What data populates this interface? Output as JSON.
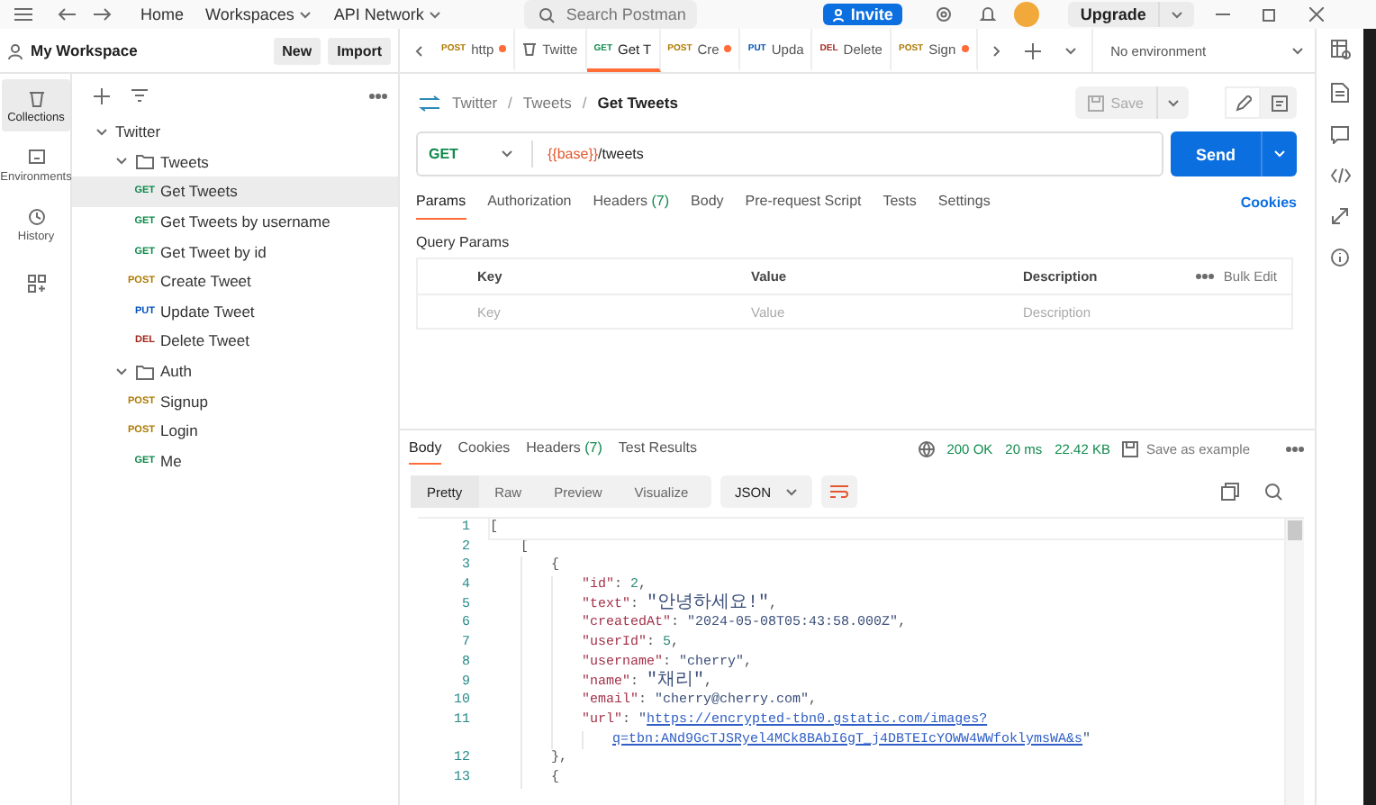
{
  "top_bar": {
    "nav": [
      {
        "label": "Home",
        "dropdown": false
      },
      {
        "label": "Workspaces",
        "dropdown": true
      },
      {
        "label": "API Network",
        "dropdown": true
      }
    ],
    "search": {
      "placeholder": "Search Postman"
    },
    "invite": "Invite",
    "upgrade": "Upgrade"
  },
  "workspace": {
    "name": "My Workspace",
    "buttons": [
      "New",
      "Import"
    ]
  },
  "nav_rail": [
    {
      "kind": "collections",
      "label": "Collections",
      "selected": true
    },
    {
      "kind": "environments",
      "label": "Environments",
      "selected": false
    },
    {
      "kind": "history",
      "label": "History",
      "selected": false
    },
    {
      "kind": "apps",
      "selected": false
    }
  ],
  "tree": [
    {
      "kind": "collection",
      "label": "Twitter",
      "expanded": true,
      "children": [
        {
          "kind": "folder",
          "label": "Tweets",
          "expanded": true,
          "children": [
            {
              "kind": "request",
              "method": "GET",
              "color": "#0f8a4c",
              "label": "Get Tweets",
              "selected": true
            },
            {
              "kind": "request",
              "method": "GET",
              "color": "#0f8a4c",
              "label": "Get Tweets by username",
              "selected": false
            },
            {
              "kind": "request",
              "method": "GET",
              "color": "#0f8a4c",
              "label": "Get Tweet by id",
              "selected": false
            },
            {
              "kind": "request",
              "method": "POST",
              "color": "#ad7a03",
              "label": "Create Tweet",
              "selected": false
            },
            {
              "kind": "request",
              "method": "PUT",
              "color": "#0053b8",
              "label": "Update Tweet",
              "selected": false
            },
            {
              "kind": "request",
              "method": "DEL",
              "color": "#a1261b",
              "label": "Delete Tweet",
              "selected": false
            }
          ]
        },
        {
          "kind": "folder",
          "label": "Auth",
          "expanded": true,
          "children": [
            {
              "kind": "request",
              "method": "POST",
              "color": "#ad7a03",
              "label": "Signup",
              "selected": false
            },
            {
              "kind": "request",
              "method": "POST",
              "color": "#ad7a03",
              "label": "Login",
              "selected": false
            },
            {
              "kind": "request",
              "method": "GET",
              "color": "#0f8a4c",
              "label": "Me",
              "selected": false
            }
          ]
        }
      ]
    }
  ],
  "tabs": [
    {
      "kind": "request",
      "method": "POST",
      "color": "#ad7a03",
      "label": "http",
      "unsaved": true,
      "selected": false
    },
    {
      "kind": "collection",
      "label": "Twitte",
      "unsaved": false,
      "selected": false
    },
    {
      "kind": "request",
      "method": "GET",
      "color": "#0f8a4c",
      "label": "Get T",
      "unsaved": false,
      "selected": true
    },
    {
      "kind": "request",
      "method": "POST",
      "color": "#ad7a03",
      "label": "Cre",
      "unsaved": true,
      "selected": false
    },
    {
      "kind": "request",
      "method": "PUT",
      "color": "#0053b8",
      "label": "Upda",
      "unsaved": false,
      "selected": false
    },
    {
      "kind": "request",
      "method": "DEL",
      "color": "#a1261b",
      "label": "Delete",
      "unsaved": false,
      "selected": false
    },
    {
      "kind": "request",
      "method": "POST",
      "color": "#ad7a03",
      "label": "Sign",
      "unsaved": true,
      "selected": false
    }
  ],
  "environment": "No environment",
  "breadcrumb": [
    {
      "label": "Twitter",
      "separator": "/"
    },
    {
      "label": "Tweets",
      "separator": "/"
    },
    {
      "label": "Get Tweets"
    }
  ],
  "save": "Save",
  "request": {
    "method": "GET",
    "url_variable": "{{base}}",
    "url_path": "/tweets",
    "send": "Send"
  },
  "request_tabs": [
    {
      "label": "Params",
      "selected": true
    },
    {
      "label": "Authorization",
      "selected": false
    },
    {
      "label": "Headers",
      "count": "(7)",
      "selected": false
    },
    {
      "label": "Body",
      "selected": false
    },
    {
      "label": "Pre-request Script",
      "selected": false
    },
    {
      "label": "Tests",
      "selected": false
    },
    {
      "label": "Settings",
      "selected": false
    }
  ],
  "cookies": "Cookies",
  "query_params": {
    "title": "Query Params",
    "columns": [
      "Key",
      "Value",
      "Description"
    ],
    "bulk_edit": "Bulk Edit",
    "placeholders": [
      "Key",
      "Value",
      "Description"
    ]
  },
  "response": {
    "tabs": [
      {
        "label": "Body",
        "selected": true
      },
      {
        "label": "Cookies",
        "selected": false
      },
      {
        "label": "Headers",
        "count": "(7)",
        "selected": false
      },
      {
        "label": "Test Results",
        "selected": false
      }
    ],
    "status": "200 OK",
    "time": "20 ms",
    "size": "22.42 KB",
    "save_example": "Save as example",
    "views": [
      {
        "label": "Pretty",
        "selected": true
      },
      {
        "label": "Raw",
        "selected": false
      },
      {
        "label": "Preview",
        "selected": false
      },
      {
        "label": "Visualize",
        "selected": false
      }
    ],
    "format": "JSON",
    "lines": [
      {
        "number": "1",
        "tokens": [
          {
            "kind": "punct",
            "text": "["
          }
        ],
        "children": [
          {
            "number": "2",
            "tokens": [
              {
                "kind": "punct",
                "text": "["
              }
            ],
            "children": [
              {
                "number": "3",
                "tokens": [
                  {
                    "kind": "punct",
                    "text": "{"
                  }
                ],
                "children": [
                  {
                    "number": "4",
                    "tokens": [
                      {
                        "kind": "key",
                        "text": "\"id\""
                      },
                      {
                        "kind": "punct",
                        "text": ": "
                      },
                      {
                        "kind": "number",
                        "text": "2"
                      },
                      {
                        "kind": "punct",
                        "text": ","
                      }
                    ]
                  },
                  {
                    "number": "5",
                    "tokens": [
                      {
                        "kind": "key",
                        "text": "\"text\""
                      },
                      {
                        "kind": "punct",
                        "text": ": "
                      },
                      {
                        "kind": "string_ko",
                        "text": "\"안녕하세요!\""
                      },
                      {
                        "kind": "punct",
                        "text": ","
                      }
                    ]
                  },
                  {
                    "number": "6",
                    "tokens": [
                      {
                        "kind": "key",
                        "text": "\"createdAt\""
                      },
                      {
                        "kind": "punct",
                        "text": ": "
                      },
                      {
                        "kind": "string",
                        "text": "\"2024-05-08T05:43:58.000Z\""
                      },
                      {
                        "kind": "punct",
                        "text": ","
                      }
                    ]
                  },
                  {
                    "number": "7",
                    "tokens": [
                      {
                        "kind": "key",
                        "text": "\"userId\""
                      },
                      {
                        "kind": "punct",
                        "text": ": "
                      },
                      {
                        "kind": "number",
                        "text": "5"
                      },
                      {
                        "kind": "punct",
                        "text": ","
                      }
                    ]
                  },
                  {
                    "number": "8",
                    "tokens": [
                      {
                        "kind": "key",
                        "text": "\"username\""
                      },
                      {
                        "kind": "punct",
                        "text": ": "
                      },
                      {
                        "kind": "string",
                        "text": "\"cherry\""
                      },
                      {
                        "kind": "punct",
                        "text": ","
                      }
                    ]
                  },
                  {
                    "number": "9",
                    "tokens": [
                      {
                        "kind": "key",
                        "text": "\"name\""
                      },
                      {
                        "kind": "punct",
                        "text": ": "
                      },
                      {
                        "kind": "string_ko",
                        "text": "\"채리\""
                      },
                      {
                        "kind": "punct",
                        "text": ","
                      }
                    ]
                  },
                  {
                    "number": "10",
                    "tokens": [
                      {
                        "kind": "key",
                        "text": "\"email\""
                      },
                      {
                        "kind": "punct",
                        "text": ": "
                      },
                      {
                        "kind": "string",
                        "text": "\"cherry@cherry.com\""
                      },
                      {
                        "kind": "punct",
                        "text": ","
                      }
                    ]
                  },
                  {
                    "number": "11",
                    "tokens": [
                      {
                        "kind": "key",
                        "text": "\"url\""
                      },
                      {
                        "kind": "punct",
                        "text": ": "
                      },
                      {
                        "kind": "string",
                        "text": "\""
                      },
                      {
                        "kind": "link",
                        "text": "https://encrypted-tbn0.gstatic.com/images?"
                      }
                    ],
                    "children": [
                      {
                        "tokens": [
                          {
                            "kind": "link",
                            "text": "q=tbn:ANd9GcTJSRyel4MCk8BAbI6gT_j4DBTEIcYOWW4WWfoklymsWA&s"
                          },
                          {
                            "kind": "string",
                            "text": "\""
                          }
                        ]
                      }
                    ]
                  }
                ]
              },
              {
                "number": "12",
                "tokens": [
                  {
                    "kind": "punct",
                    "text": "},"
                  }
                ]
              },
              {
                "number": "13",
                "tokens": [
                  {
                    "kind": "punct",
                    "text": "{"
                  }
                ]
              }
            ]
          }
        ]
      }
    ]
  }
}
